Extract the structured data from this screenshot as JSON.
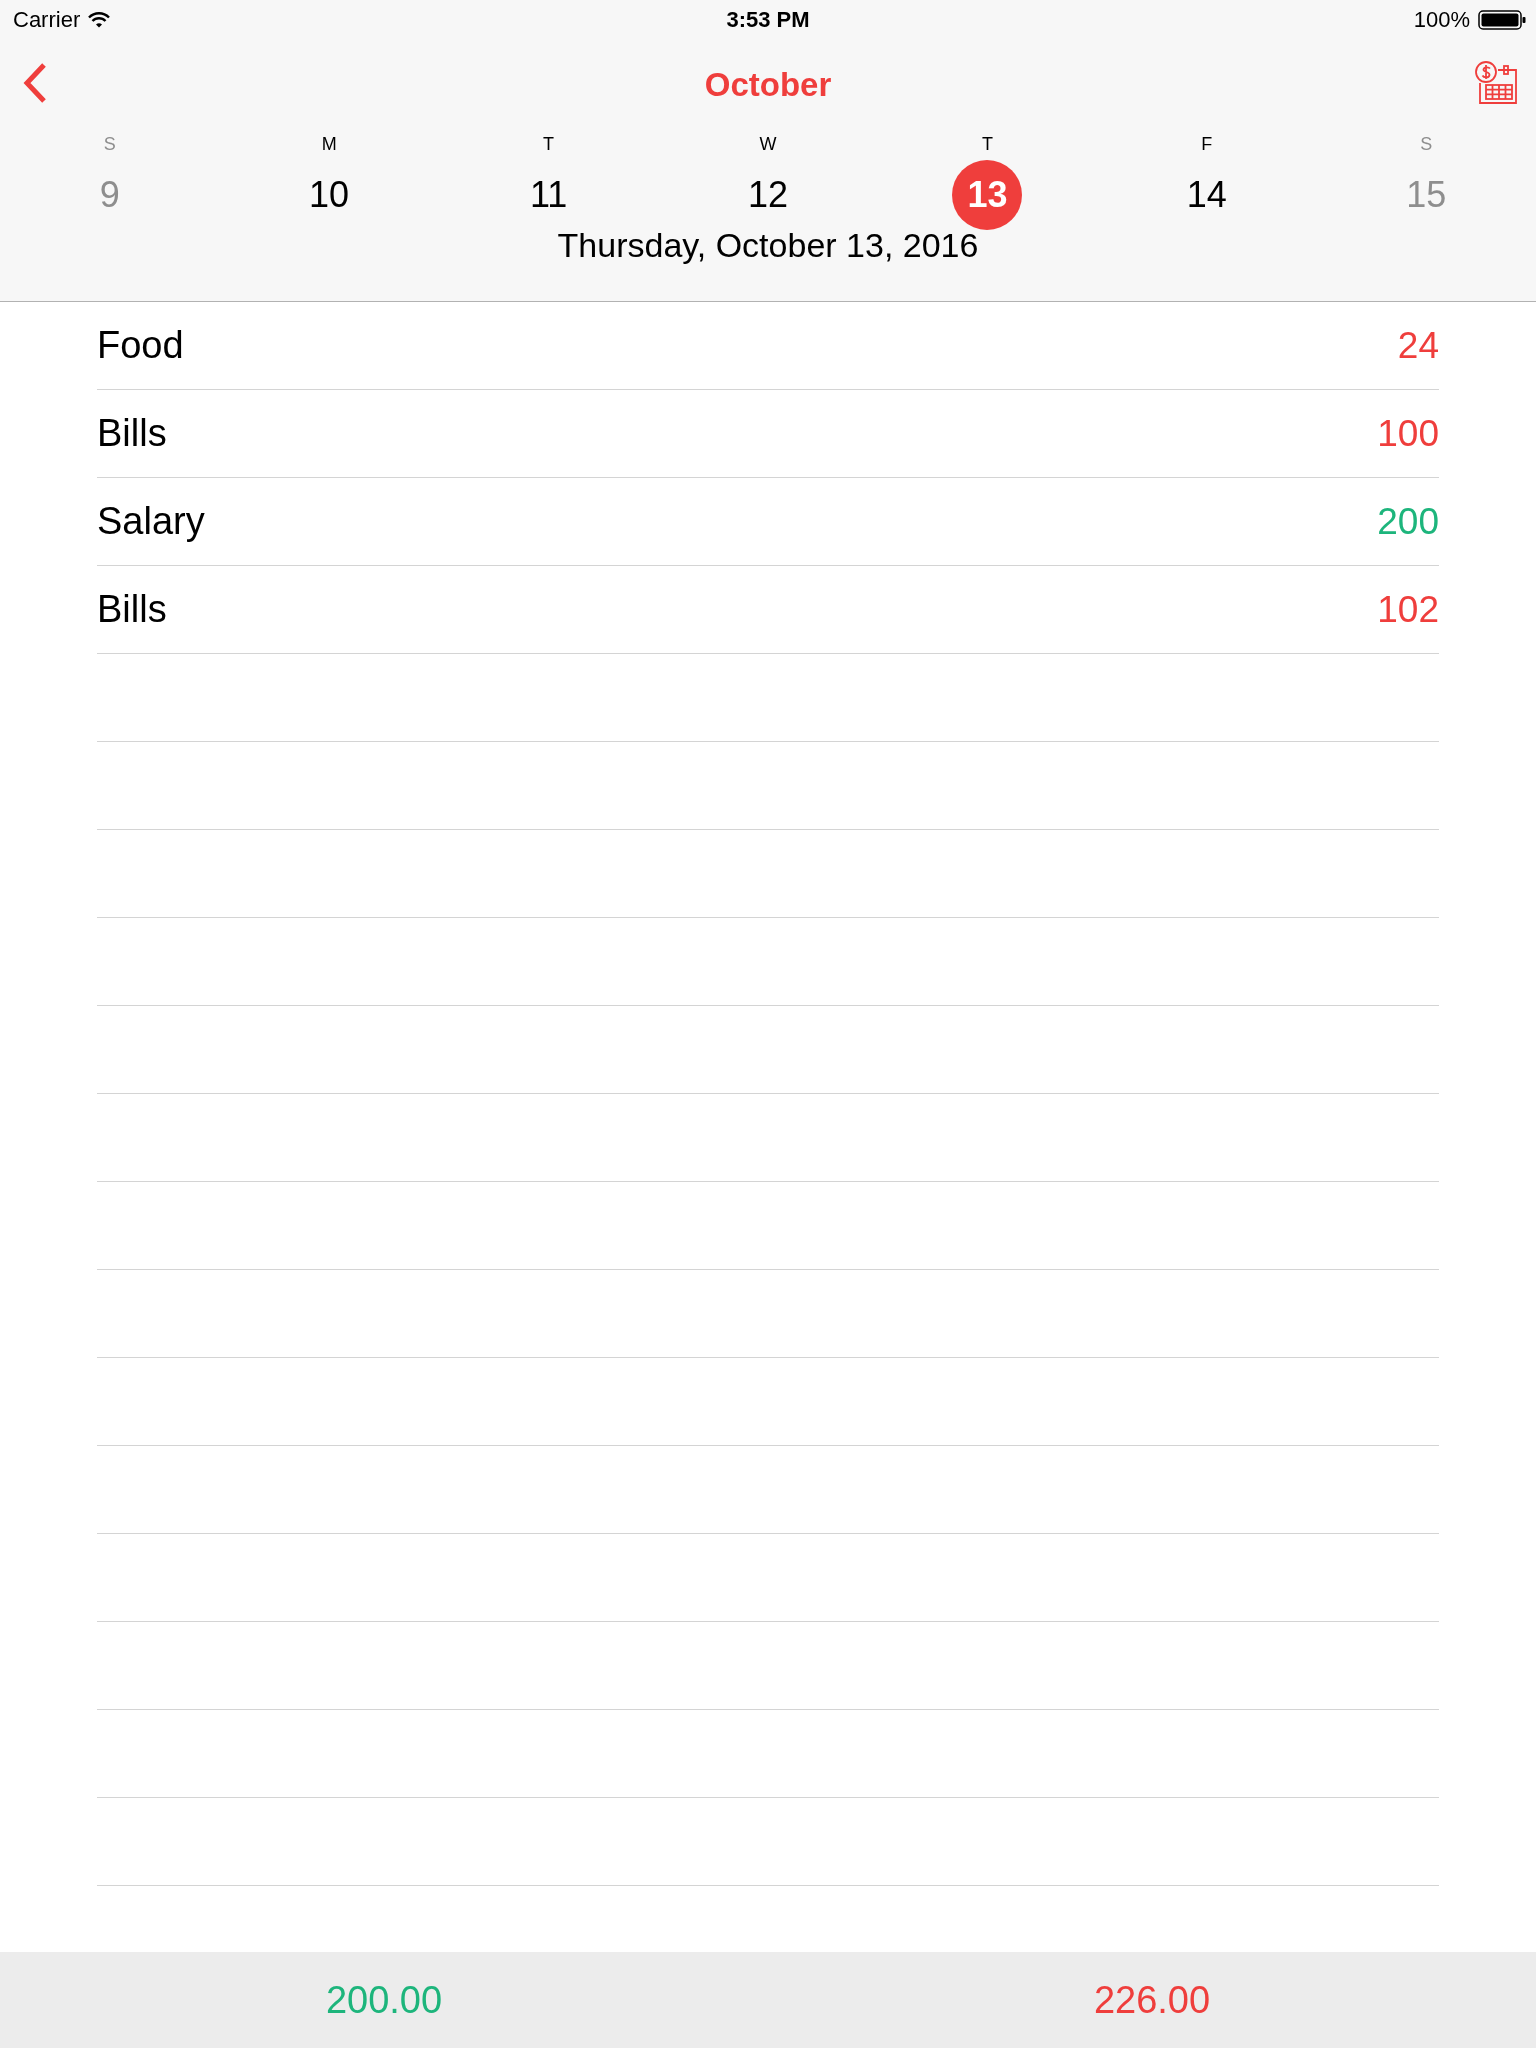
{
  "status_bar": {
    "carrier": "Carrier",
    "time": "3:53 PM",
    "battery": "100%"
  },
  "nav": {
    "title": "October"
  },
  "week": [
    {
      "letter": "S",
      "day": "9",
      "weekend": true,
      "selected": false
    },
    {
      "letter": "M",
      "day": "10",
      "weekend": false,
      "selected": false
    },
    {
      "letter": "T",
      "day": "11",
      "weekend": false,
      "selected": false
    },
    {
      "letter": "W",
      "day": "12",
      "weekend": false,
      "selected": false
    },
    {
      "letter": "T",
      "day": "13",
      "weekend": false,
      "selected": true
    },
    {
      "letter": "F",
      "day": "14",
      "weekend": false,
      "selected": false
    },
    {
      "letter": "S",
      "day": "15",
      "weekend": true,
      "selected": false
    }
  ],
  "selected_date": "Thursday, October 13, 2016",
  "entries": [
    {
      "name": "Food",
      "amount": "24",
      "kind": "expense"
    },
    {
      "name": "Bills",
      "amount": "100",
      "kind": "expense"
    },
    {
      "name": "Salary",
      "amount": "200",
      "kind": "income"
    },
    {
      "name": "Bills",
      "amount": "102",
      "kind": "expense"
    }
  ],
  "totals": [
    {
      "value": "200.00",
      "kind": "income"
    },
    {
      "value": "226.00",
      "kind": "expense"
    }
  ]
}
